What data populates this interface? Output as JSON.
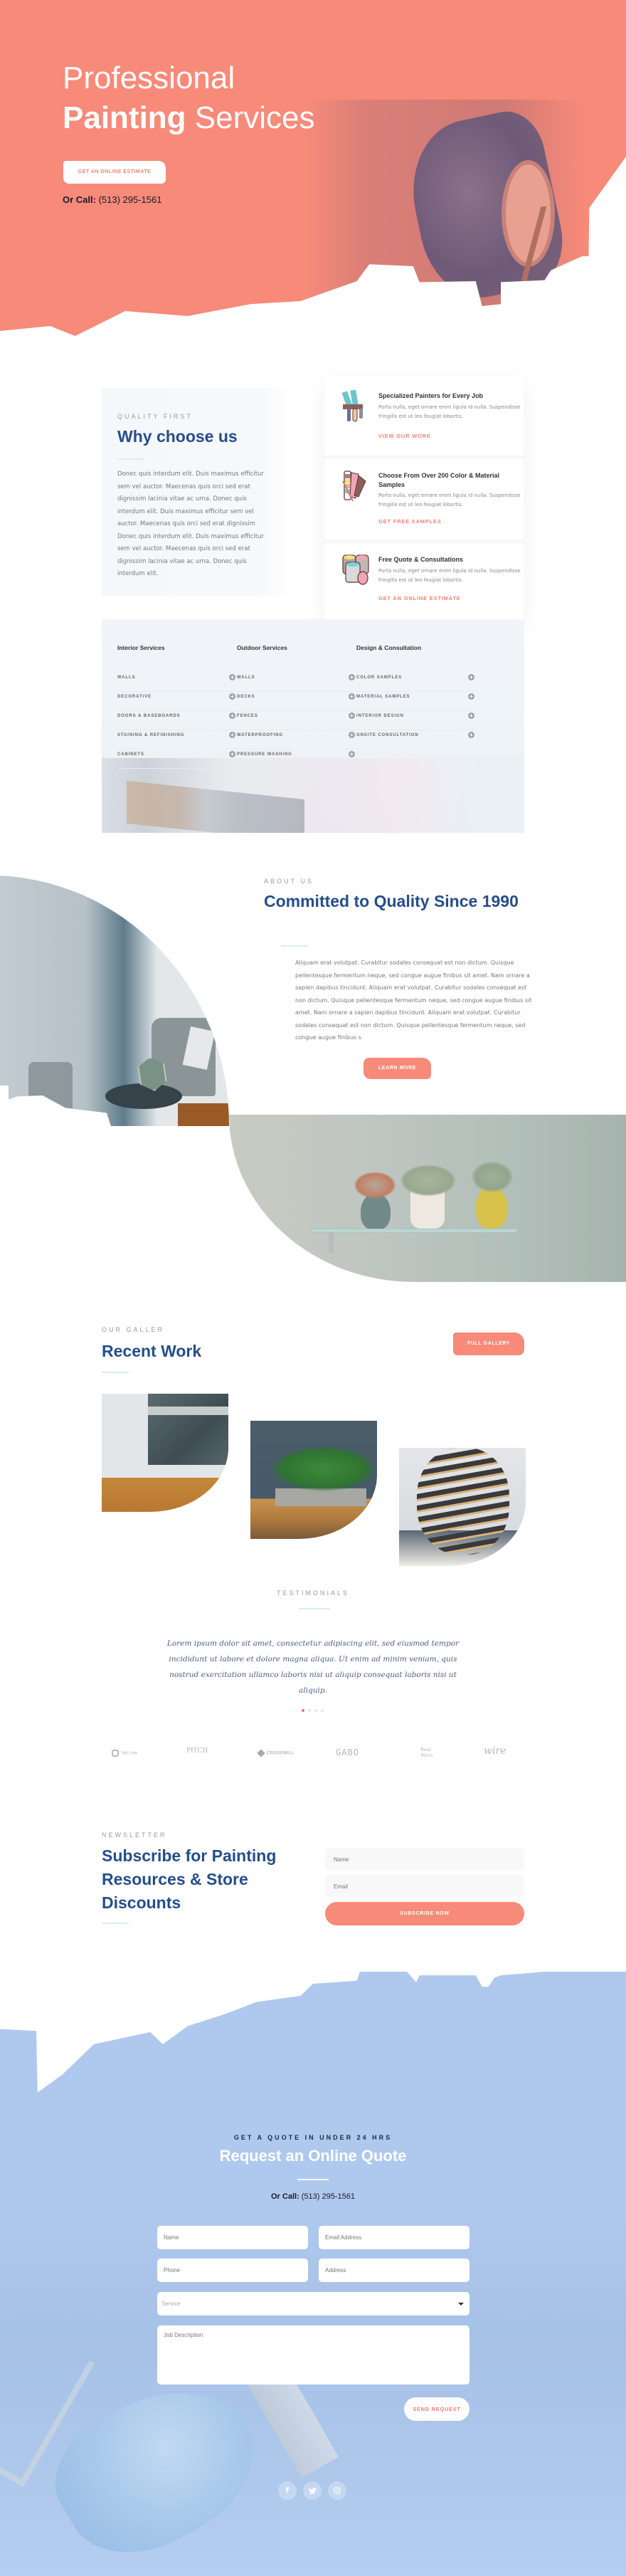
{
  "hero": {
    "title_line1": "Professional",
    "title_bold": "Painting",
    "title_rest": " Services",
    "cta_label": "GET AN ONLINE ESTIMATE",
    "call_label": "Or Call:",
    "call_number": " (513) 295-1561"
  },
  "why": {
    "eyebrow": "QUALITY FIRST",
    "heading": "Why choose us",
    "body": "Donec quis interdum elit. Duis maximus efficitur sem vel auctor. Maecenas quis orci sed erat dignissim lacinia vitae ac urna. Donec quis interdum elit. Duis maximus efficitur sem vel auctor. Maecenas quis orci sed erat dignissim Donec quis interdum elit. Duis maximus efficitur sem vel auctor. Maecenas quis orci sed erat dignissim lacinia vitae ac urna. Donec quis interdum elit.",
    "cards": [
      {
        "icon": "paintbrushes-icon",
        "title": "Specialized Painters for Every Job",
        "text": "Porta nulla, eget ornare enim ligula id nulla. Suspendisse fringilla est ut leo feugiat lobortis.",
        "link": "VIEW OUR WORK"
      },
      {
        "icon": "color-swatches-icon",
        "title": "Choose From Over 200 Color & Material Samples",
        "text": "Porta nulla, eget ornare enim ligula id nulla. Suspendisse fringilla est ut leo feugiat lobortis.",
        "link": "GET FREE SAMPLES"
      },
      {
        "icon": "paint-cans-icon",
        "title": "Free Quote & Consultations",
        "text": "Porta nulla, eget ornare enim ligula id nulla. Suspendisse fringilla est ut leo feugiat lobortis.",
        "link": "GET AN ONLINE ESTIMATE"
      }
    ]
  },
  "services": {
    "columns": [
      {
        "heading": "Interior Services",
        "items": [
          "WALLS",
          "DECORATIVE",
          "DOORS & BASEBOARDS",
          "STAINING & REFINISHING",
          "CABINETS"
        ]
      },
      {
        "heading": "Outdoor Services",
        "items": [
          "WALLS",
          "DECKS",
          "FENCES",
          "WATERPROOFING",
          "PRESSURE WASHING"
        ]
      },
      {
        "heading": "Design & Consultation",
        "items": [
          "COLOR SAMPLES",
          "MATERIAL SAMPLES",
          "INTERIOR DESIGN",
          "ONSITE CONSULTATION"
        ]
      }
    ],
    "expand_icon": "+"
  },
  "about": {
    "eyebrow": "ABOUT US",
    "heading": "Committed to Quality Since 1990",
    "body": "Aliquam erat volutpat. Curabitur sodales consequat est non dictum. Quisque pellentesque fermentum neque, sed congue augue finibus sit amet. Nam ornare a sapien dapibus tincidunt. Aliquam erat volutpat. Curabitur sodales consequat est non dictum. Quisque pellentesque fermentum neque, sed congue augue finibus sit amet. Nam ornare a sapien dapibus tincidunt. Aliquam erat volutpat. Curabitur sodales consequat est non dictum. Quisque pellentesque fermentum neque, sed congue augue finibus s",
    "button": "LEARN MORE"
  },
  "gallery": {
    "eyebrow": "OUR GALLER",
    "heading": "Recent Work",
    "button": "FULL GALLERY"
  },
  "testimonials": {
    "eyebrow": "TESTIMONIALS",
    "quote": "Lorem ipsum dolor sit amet, consectetur adipiscing elit, sed eiusmod tempor incididunt ut labore et dolore magna aliqua. Ut enim ad minim veniam, quis nostrud exercitation ullamco laboris nisi ut aliquip consequat laboris nisi ut aliquip.",
    "slides": 4,
    "active_slide": 1
  },
  "logos": [
    "Job Line",
    "PITCH",
    "CROSSWILL",
    "GABO",
    "Real Wave",
    "wire"
  ],
  "newsletter": {
    "eyebrow": "NEWSLETTER",
    "heading": "Subscribe for Painting Resources & Store Discounts",
    "name_placeholder": "Name",
    "email_placeholder": "Email",
    "button": "SUBSCRIBE NOW"
  },
  "quote": {
    "eyebrow": "GET A QUOTE IN UNDER 24 HRS",
    "heading": "Request an Online Quote",
    "call_label": "Or Call:",
    "call_number": " (513) 295-1561",
    "fields": {
      "name": "Name",
      "email": "Email Address",
      "phone": "Phone",
      "address": "Address",
      "service": "Service",
      "description": "Job Description"
    },
    "button": "SEND REQUEST"
  },
  "social": [
    {
      "icon": "facebook-icon",
      "glyph": "f"
    },
    {
      "icon": "twitter-icon",
      "glyph": "t"
    },
    {
      "icon": "instagram-icon",
      "glyph": "◎"
    }
  ],
  "colors": {
    "accent": "#f78a79",
    "heading_blue": "#254e8a",
    "quote_blue": "#afc8ee"
  }
}
